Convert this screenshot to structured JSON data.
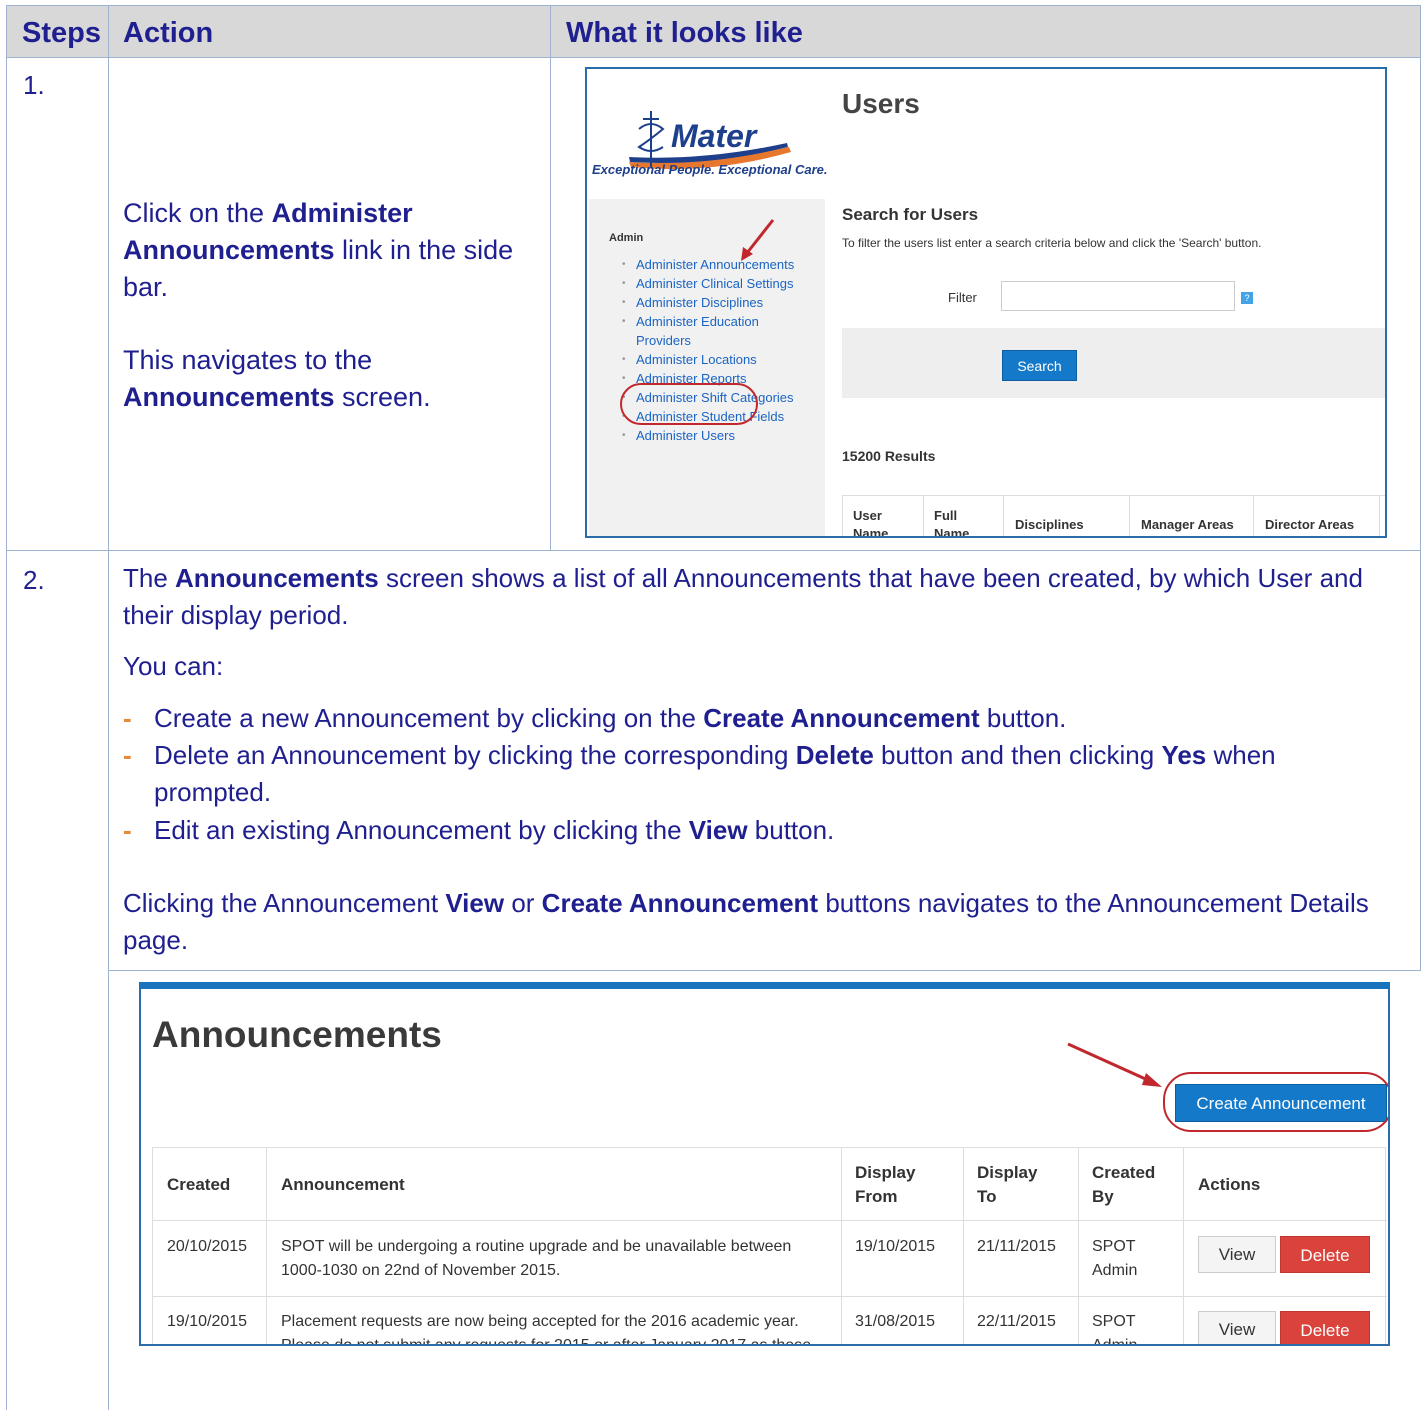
{
  "table_header": {
    "steps": "Steps",
    "action": "Action",
    "looks_like": "What it looks like"
  },
  "step1": {
    "number": "1.",
    "line1_pre": "Click on the ",
    "line1_bold": "Administer Announcements",
    "line1_post": " link in the side bar.",
    "line2_pre": "This navigates to the ",
    "line2_bold": "Announcements",
    "line2_post": " screen.",
    "screenshot": {
      "logo_text": "Mater",
      "tagline": "Exceptional People. Exceptional Care.",
      "sidebar_heading": "Admin",
      "sidebar_links": [
        "Administer Announcements",
        "Administer Clinical Settings",
        "Administer Disciplines",
        "Administer Education Providers",
        "Administer Locations",
        "Administer Reports",
        "Administer Shift Categories",
        "Administer Student Fields",
        "Administer Users"
      ],
      "page_title": "Users",
      "search_heading": "Search for Users",
      "search_description": "To filter the users list enter a search criteria below and click the 'Search' button.",
      "filter_label": "Filter",
      "filter_value": "",
      "help_glyph": "?",
      "search_button": "Search",
      "results": "15200 Results",
      "columns": [
        "User Name",
        "Full Name",
        "Disciplines",
        "Manager Areas",
        "Director Areas"
      ]
    }
  },
  "step2": {
    "number": "2.",
    "intro_pre": "The ",
    "intro_bold": "Announcements",
    "intro_post": " screen shows a list of all Announcements that have been created, by which User and their display period.",
    "you_can": "You can:",
    "bullets": [
      {
        "pre": "Create a new Announcement by clicking on the ",
        "bold": "Create Announcement",
        "post": " button."
      },
      {
        "pre": "Delete an Announcement by clicking the corresponding ",
        "bold": "Delete",
        "mid": " button and then clicking ",
        "bold2": "Yes",
        "post": " when prompted."
      },
      {
        "pre": "Edit an existing Announcement by clicking the ",
        "bold": "View",
        "post": " button."
      }
    ],
    "closing_1": "Clicking the Announcement ",
    "closing_bold1": "View",
    "closing_2": " or ",
    "closing_bold2": "Create Announcement",
    "closing_3": " buttons navigates to the Announcement Details page.",
    "screenshot": {
      "title": "Announcements",
      "create_button": "Create Announcement",
      "headers": {
        "created": "Created",
        "announcement": "Announcement",
        "display_from": "Display From",
        "display_to": "Display To",
        "created_by": "Created By",
        "actions": "Actions"
      },
      "rows": [
        {
          "created": "20/10/2015",
          "announcement": "SPOT will be undergoing a routine upgrade and be unavailable between 1000-1030 on 22nd of November 2015.",
          "display_from": "19/10/2015",
          "display_to": "21/11/2015",
          "created_by": "SPOT Admin",
          "view": "View",
          "delete": "Delete"
        },
        {
          "created": "19/10/2015",
          "announcement": "Placement requests are now being accepted for the 2016 academic year. Please do not submit any requests for 2015 or after January 2017 as these will not be considered at this time.",
          "display_from": "31/08/2015",
          "display_to": "22/11/2015",
          "created_by": "SPOT Admin",
          "view": "View",
          "delete": "Delete"
        }
      ]
    }
  },
  "colors": {
    "text_navy": "#1f1f8f",
    "header_gray": "#d8d8d8",
    "border_blue": "#2b6dab",
    "button_blue": "#1479c9",
    "delete_red": "#d9433c",
    "highlight_ring": "#c0282e",
    "bullet_orange": "#e58a3a"
  }
}
